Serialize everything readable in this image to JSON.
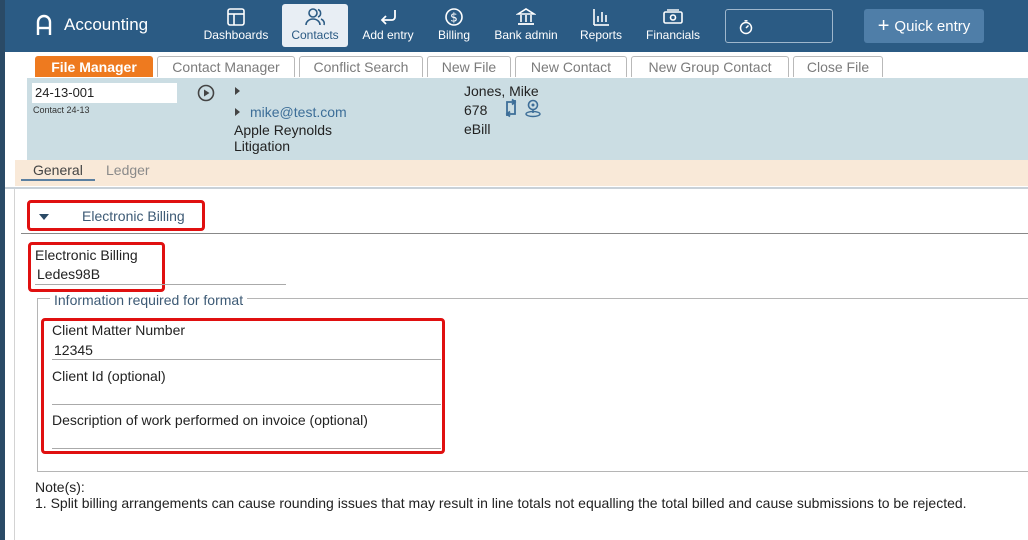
{
  "app": {
    "title": "Accounting"
  },
  "nav": [
    {
      "label": "Dashboards",
      "icon": "dashboard-icon"
    },
    {
      "label": "Contacts",
      "icon": "contacts-icon",
      "active": true
    },
    {
      "label": "Add entry",
      "icon": "return-arrow-icon"
    },
    {
      "label": "Billing",
      "icon": "dollar-icon"
    },
    {
      "label": "Bank admin",
      "icon": "bank-icon"
    },
    {
      "label": "Reports",
      "icon": "bar-chart-icon"
    },
    {
      "label": "Financials",
      "icon": "cash-icon"
    }
  ],
  "quick_entry": {
    "label": "Quick entry"
  },
  "tabs": [
    "File Manager",
    "Contact Manager",
    "Conflict Search",
    "New File",
    "New Contact",
    "New Group Contact",
    "Close File"
  ],
  "contact": {
    "matter_number": "24-13-001",
    "matter_sub": "Contact 24-13",
    "email": "mike@test.com",
    "client_name": "Apple Reynolds",
    "practice_area": "Litigation",
    "responsible": "Jones, Mike",
    "number": "678",
    "billing_type": "eBill"
  },
  "subtabs": [
    "General",
    "Ledger"
  ],
  "section": {
    "title": "Electronic Billing"
  },
  "electronic_billing": {
    "label": "Electronic Billing",
    "value": "Ledes98B"
  },
  "format_info": {
    "legend": "Information required for format",
    "fields": [
      {
        "label": "Client Matter Number",
        "value": "12345"
      },
      {
        "label": "Client Id (optional)",
        "value": ""
      },
      {
        "label": "Description of work performed on invoice (optional)",
        "value": ""
      }
    ]
  },
  "notes": {
    "title": "Note(s):",
    "items": [
      "1. Split billing arrangements can cause rounding issues that may result in line totals not equalling the total billed and cause submissions to be rejected."
    ]
  },
  "colors": {
    "nav_bg": "#2b5b84",
    "active_tab": "#ee7a1f",
    "highlight": "#e01010",
    "panel_bg": "#cbdde3",
    "subtab_bg": "#f9e9d8"
  }
}
